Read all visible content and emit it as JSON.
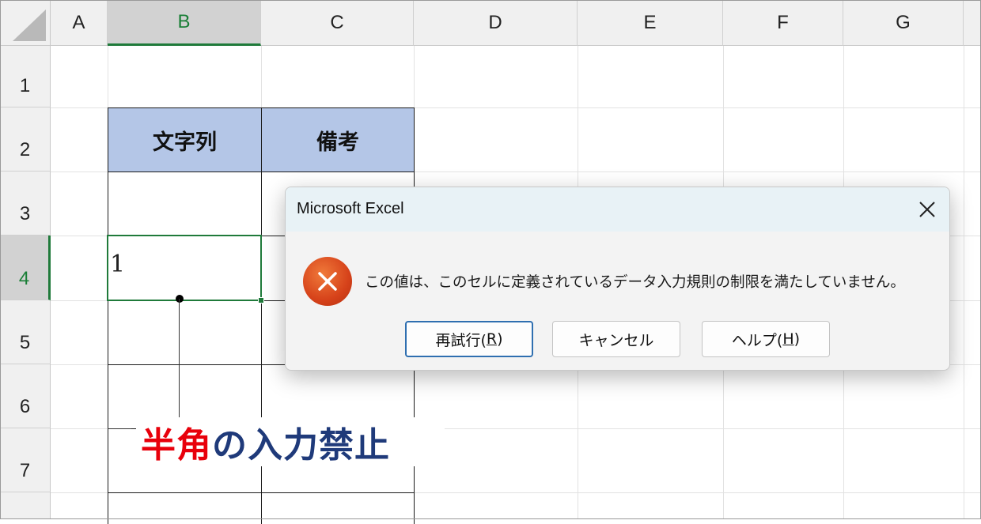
{
  "sheet": {
    "columns": [
      "A",
      "B",
      "C",
      "D",
      "E",
      "F",
      "G"
    ],
    "rows": [
      "1",
      "2",
      "3",
      "4",
      "5",
      "6",
      "7"
    ],
    "selected_column": "B",
    "selected_row": "4",
    "table": {
      "header_1": "文字列",
      "header_2": "備考",
      "header_color": "#b4c6e7"
    },
    "active_cell_value": "1"
  },
  "callout": {
    "part_red": "半角",
    "part_navy": "の入力禁止",
    "red_color": "#e8000b",
    "navy_color": "#1f3a7a"
  },
  "dialog": {
    "title": "Microsoft Excel",
    "icon": "error-icon",
    "message": "この値は、このセルに定義されているデータ入力規則の制限を満たしていません。",
    "buttons": {
      "retry_prefix": "再試行(",
      "retry_key": "R",
      "retry_suffix": ")",
      "cancel": "キャンセル",
      "help_prefix": "ヘルプ(",
      "help_key": "H",
      "help_suffix": ")"
    }
  }
}
